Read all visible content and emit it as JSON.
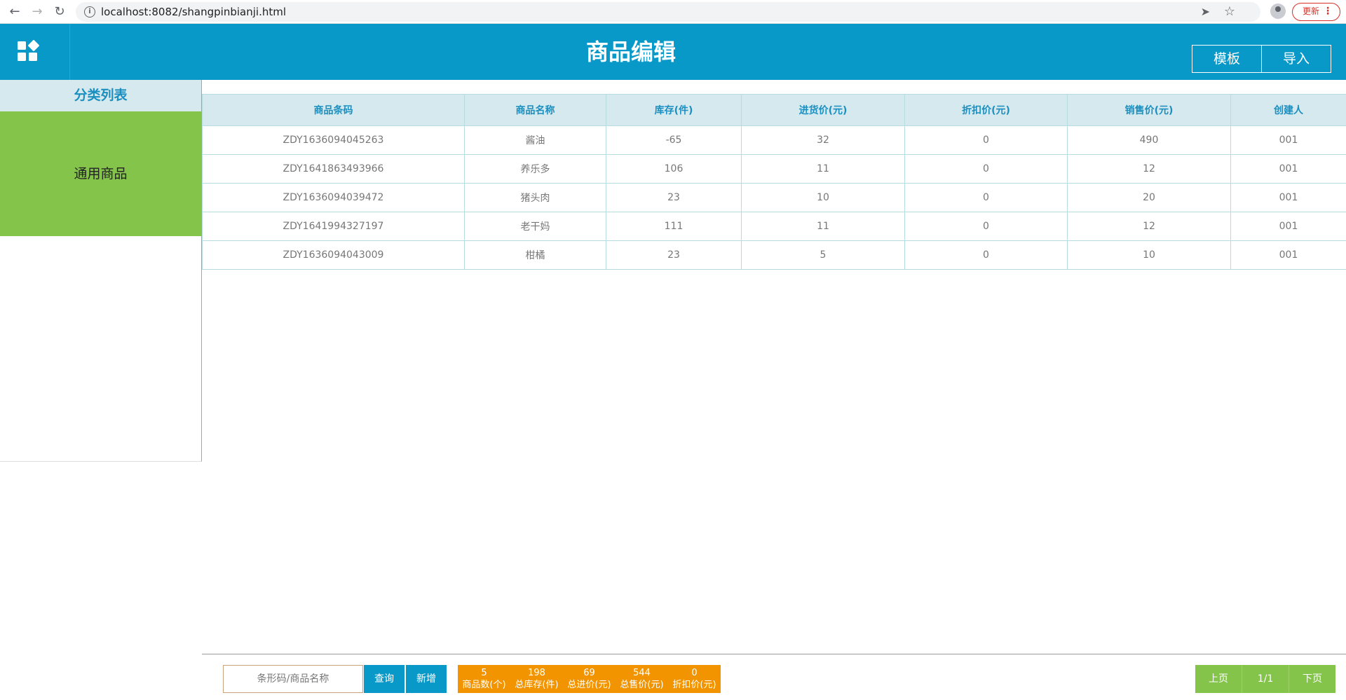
{
  "browser": {
    "url": "localhost:8082/shangpinbianji.html",
    "update_label": "更新"
  },
  "header": {
    "title": "商品编辑",
    "buttons": {
      "template": "模板",
      "import": "导入"
    },
    "brand_color": "#0999c9"
  },
  "sidebar": {
    "title": "分类列表",
    "items": [
      {
        "label": "通用商品",
        "selected": true
      }
    ],
    "active_color": "#85c44b"
  },
  "table": {
    "columns": [
      "商品条码",
      "商品名称",
      "库存(件)",
      "进货价(元)",
      "折扣价(元)",
      "销售价(元)",
      "创建人"
    ],
    "rows": [
      [
        "ZDY1636094045263",
        "酱油",
        "-65",
        "32",
        "0",
        "490",
        "001"
      ],
      [
        "ZDY1641863493966",
        "养乐多",
        "106",
        "11",
        "0",
        "12",
        "001"
      ],
      [
        "ZDY1636094039472",
        "猪头肉",
        "23",
        "10",
        "0",
        "20",
        "001"
      ],
      [
        "ZDY1641994327197",
        "老干妈",
        "111",
        "11",
        "0",
        "12",
        "001"
      ],
      [
        "ZDY1636094043009",
        "柑橘",
        "23",
        "5",
        "0",
        "10",
        "001"
      ]
    ]
  },
  "footer": {
    "search_placeholder": "条形码/商品名称",
    "query_label": "查询",
    "add_label": "新增",
    "stats": [
      {
        "value": "5",
        "label": "商品数(个)"
      },
      {
        "value": "198",
        "label": "总库存(件)"
      },
      {
        "value": "69",
        "label": "总进价(元)"
      },
      {
        "value": "544",
        "label": "总售价(元)"
      },
      {
        "value": "0",
        "label": "折扣价(元)"
      }
    ],
    "pager": {
      "prev": "上页",
      "page": "1/1",
      "next": "下页"
    },
    "stats_color": "#f29400"
  }
}
